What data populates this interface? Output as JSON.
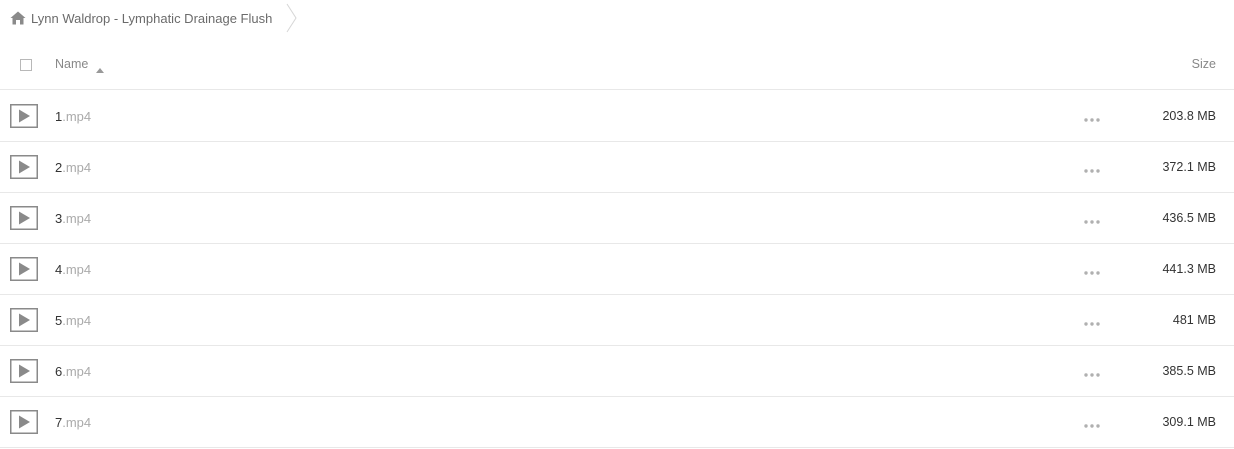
{
  "breadcrumb": {
    "home_icon": "home-icon",
    "label": "Lynn Waldrop - Lymphatic Drainage Flush"
  },
  "header": {
    "name_label": "Name",
    "size_label": "Size",
    "sort_icon": "sort-ascending-icon"
  },
  "files": [
    {
      "base": "1",
      "ext": ".mp4",
      "size": "203.8 MB"
    },
    {
      "base": "2",
      "ext": ".mp4",
      "size": "372.1 MB"
    },
    {
      "base": "3",
      "ext": ".mp4",
      "size": "436.5 MB"
    },
    {
      "base": "4",
      "ext": ".mp4",
      "size": "441.3 MB"
    },
    {
      "base": "5",
      "ext": ".mp4",
      "size": "481 MB"
    },
    {
      "base": "6",
      "ext": ".mp4",
      "size": "385.5 MB"
    },
    {
      "base": "7",
      "ext": ".mp4",
      "size": "309.1 MB"
    }
  ],
  "colors": {
    "icon_gray": "#8a8a8a",
    "divider": "#e8e8e8"
  }
}
